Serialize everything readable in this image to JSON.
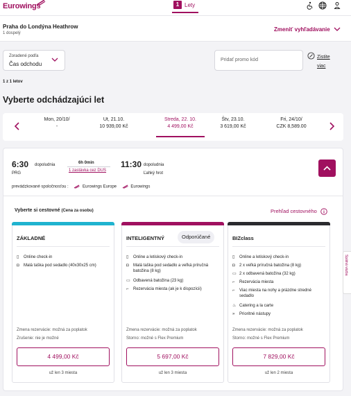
{
  "header": {
    "logo_text": "Eurowings",
    "step_number": "1",
    "step_label": "Lety",
    "icons": [
      "accessibility-icon",
      "globe-icon",
      "user-icon"
    ]
  },
  "route": {
    "title": "Praha do Londýna Heathrow",
    "passengers": "1 dospelý",
    "change_search": "Zmeniť vyhľadávanie"
  },
  "sort": {
    "label": "Zoradené podľa",
    "value": "Čas odchodu"
  },
  "promo": {
    "placeholder": "Pridať promo kód",
    "clear_link": "Zistite viac"
  },
  "results_count": "1 z 1 letov",
  "section_title": "Vyberte odchádzajúci let",
  "dates": [
    {
      "day": "Mon, 20/10/",
      "price": "-"
    },
    {
      "day": "Ut, 21.10.",
      "price": "10 939,00 Kč"
    },
    {
      "day": "Streda, 22. 10.",
      "price": "4 499,00 Kč",
      "selected": true
    },
    {
      "day": "Štv, 23.10.",
      "price": "3 619,00 Kč"
    },
    {
      "day": "Fri, 24/10/",
      "price": "CZK 8,589.00"
    }
  ],
  "flight": {
    "dep_time": "6:30",
    "dep_period": "dopoludnia",
    "dep_airport": "PRG",
    "duration": "6h 0min",
    "stops": "1 zastávka cez DUS",
    "arr_time": "11:30",
    "arr_period": "dopoludnia",
    "fare_hint": "Ľahký hrot",
    "operated_label": "prevádzkované spoločnosťou :",
    "operators": [
      "Eurowings Europe",
      "Eurowings"
    ]
  },
  "fares": {
    "choose_label": "Vyberte si cestovné",
    "choose_sub": "(Cena za osobu)",
    "overview_link": "Prehľad cestovného",
    "items": [
      {
        "name": "ZÁKLADNÉ",
        "features": [
          {
            "icon": "mobile-icon",
            "text": "Online check-in"
          },
          {
            "icon": "bag-icon",
            "text": "Malá taška pod sedadlo (40x30x25 cm)"
          }
        ],
        "change_note": "Zmena rezervácie: možná za poplatok",
        "cancel_note": "Zrušenie: nie je možné",
        "price": "4 499,00 Kč",
        "seats": "už len 3 miesta"
      },
      {
        "name": "INTELIGENTNÝ",
        "badge": "Odporúčané",
        "features": [
          {
            "icon": "mobile-icon",
            "text": "Online a letiskový check-in"
          },
          {
            "icon": "bag-icon",
            "text": "Malá taška pod sedadlo a veľká príručná batožina (8 kg)"
          },
          {
            "icon": "suitcase-icon",
            "text": "Odbavená batožina (23 kg)"
          },
          {
            "icon": "seat-icon",
            "text": "Rezervácia miesta (ak je k dispozícii)"
          }
        ],
        "change_note": "Zmena rezervácie: možná za poplatok",
        "cancel_note": "Storno: možné s Flex Premium",
        "price": "5 697,00 Kč",
        "seats": "už len 3 miesta"
      },
      {
        "name": "BIZclass",
        "features": [
          {
            "icon": "mobile-icon",
            "text": "Online a letiskový check-in"
          },
          {
            "icon": "bag-icon",
            "text": "2 x veľká príručná batožina (8 kg)"
          },
          {
            "icon": "suitcase-icon",
            "text": "2 x odbavená batožina (32 kg)"
          },
          {
            "icon": "seat-icon",
            "text": "Rezervácia miesta"
          },
          {
            "icon": "seat-icon",
            "text": "Viac miesta na nohy a prázdne stredné sedadlo"
          },
          {
            "icon": "cup-icon",
            "text": "Catering a la carte"
          },
          {
            "icon": "chevrons-icon",
            "text": "Prioritné nástupy"
          }
        ],
        "change_note": "Zmena rezervácie: možná za poplatok",
        "cancel_note": "Storno: možné s Flex Premium",
        "price": "7 829,00 Kč",
        "seats": "už len 2 miesta"
      }
    ]
  },
  "feedback_tab": "Spätná väzba",
  "colors": {
    "brand": "#a0105f",
    "basic_bar": "#1fb3cf",
    "smart_bar": "#a0105f",
    "biz_bar": "#2a2a2e"
  }
}
